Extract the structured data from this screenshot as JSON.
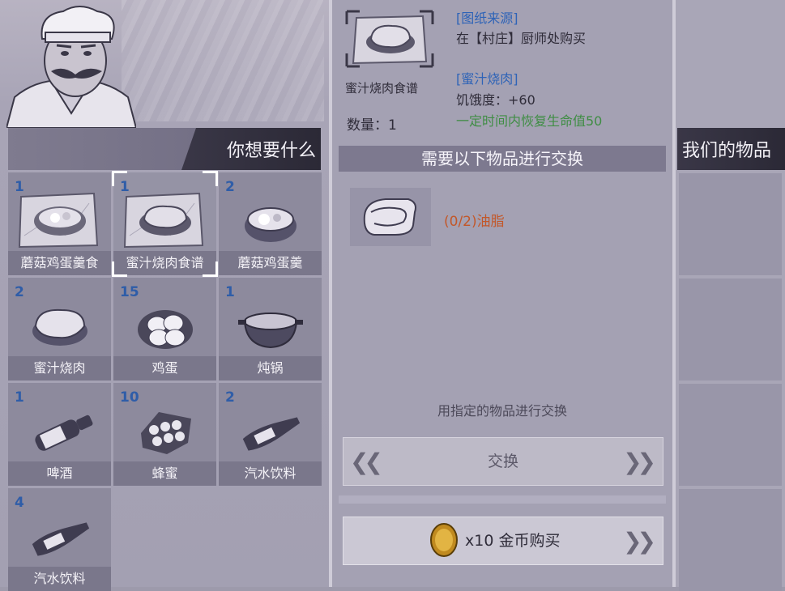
{
  "shop": {
    "title": "你想要什么",
    "items": [
      {
        "qty": "1",
        "label": "蘑菇鸡蛋羹食",
        "icon": "recipe-mushroom-egg-custard-icon"
      },
      {
        "qty": "1",
        "label": "蜜汁烧肉食谱",
        "icon": "recipe-honey-roast-meat-icon",
        "selected": true
      },
      {
        "qty": "2",
        "label": "蘑菇鸡蛋羹",
        "icon": "mushroom-egg-custard-icon"
      },
      {
        "qty": "2",
        "label": "蜜汁烧肉",
        "icon": "honey-roast-meat-icon"
      },
      {
        "qty": "15",
        "label": "鸡蛋",
        "icon": "eggs-icon"
      },
      {
        "qty": "1",
        "label": "炖锅",
        "icon": "stew-pot-icon"
      },
      {
        "qty": "1",
        "label": "啤酒",
        "icon": "beer-bottle-icon"
      },
      {
        "qty": "10",
        "label": "蜂蜜",
        "icon": "honeycomb-icon"
      },
      {
        "qty": "2",
        "label": "汽水饮料",
        "icon": "soda-bottle-icon"
      },
      {
        "qty": "4",
        "label": "汽水饮料",
        "icon": "soda-bottle-icon"
      }
    ]
  },
  "detail": {
    "name": "蜜汁烧肉食谱",
    "quantity": "数量：1",
    "source_title": "[图纸来源]",
    "source_text": "在【村庄】厨师处购买",
    "item_title": "[蜜汁烧肉]",
    "item_stat": "饥饿度：+60",
    "item_effect": "一定时间内恢复生命值50"
  },
  "exchange": {
    "header": "需要以下物品进行交换",
    "ingredient": "(0/2)油脂",
    "ingredient_icon": "grease-roll-icon",
    "hint": "用指定的物品进行交换",
    "button": "交换"
  },
  "purchase": {
    "label": "x10 金币购买",
    "icon": "gold-coin-icon"
  },
  "inventory": {
    "title": "我们的物品"
  }
}
